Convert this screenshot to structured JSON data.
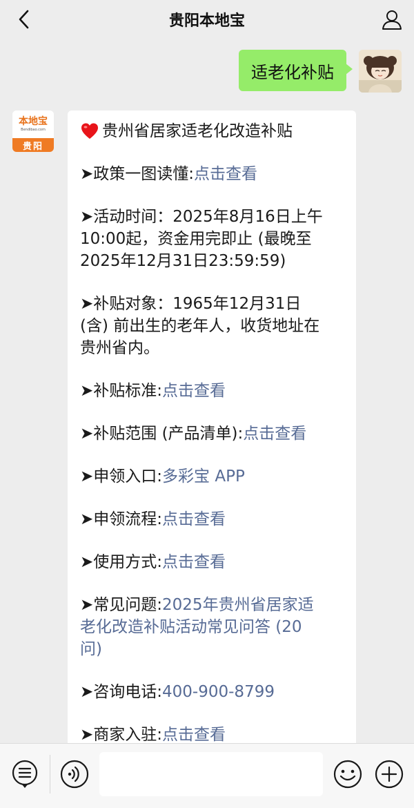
{
  "header": {
    "title": "贵阳本地宝"
  },
  "outgoing": {
    "text": "适老化补贴"
  },
  "bot": {
    "logo_main": "本地宝",
    "logo_sub": "Bendibao.com",
    "logo_city": "贵阳"
  },
  "message": {
    "title": "贵州省居家适老化改造补贴",
    "policy": {
      "label": "➤政策一图读懂:",
      "link": "点击查看"
    },
    "time": {
      "l1": "➤活动时间：2025年8月16日上午",
      "l2": "10:00起，资金用完即止 (最晚至",
      "l3": "2025年12月31日23:59:59)"
    },
    "target": {
      "l1": "➤补贴对象：1965年12月31日",
      "l2": "(含) 前出生的老年人，收货地址在",
      "l3": "贵州省内。"
    },
    "standard": {
      "label": "➤补贴标准:",
      "link": "点击查看"
    },
    "scope": {
      "label": "➤补贴范围 (产品清单):",
      "link": "点击查看"
    },
    "entry": {
      "label": "➤申领入口:",
      "link": "多彩宝 APP"
    },
    "process": {
      "label": "➤申领流程:",
      "link": "点击查看"
    },
    "usage": {
      "label": "➤使用方式:",
      "link": "点击查看"
    },
    "faq": {
      "label": "➤常见问题:",
      "link1": "2025年贵州省居家适",
      "link2": "老化改造补贴活动常见问答 (20",
      "link3": "问)"
    },
    "phone": {
      "label": "➤咨询电话:",
      "link": "400-900-8799"
    },
    "merchant": {
      "label": "➤商家入驻:",
      "link": "点击查看"
    }
  },
  "input": {
    "placeholder": ""
  },
  "colors": {
    "bubble_out": "#95ec69",
    "link": "#576b95",
    "background": "#ededed"
  }
}
